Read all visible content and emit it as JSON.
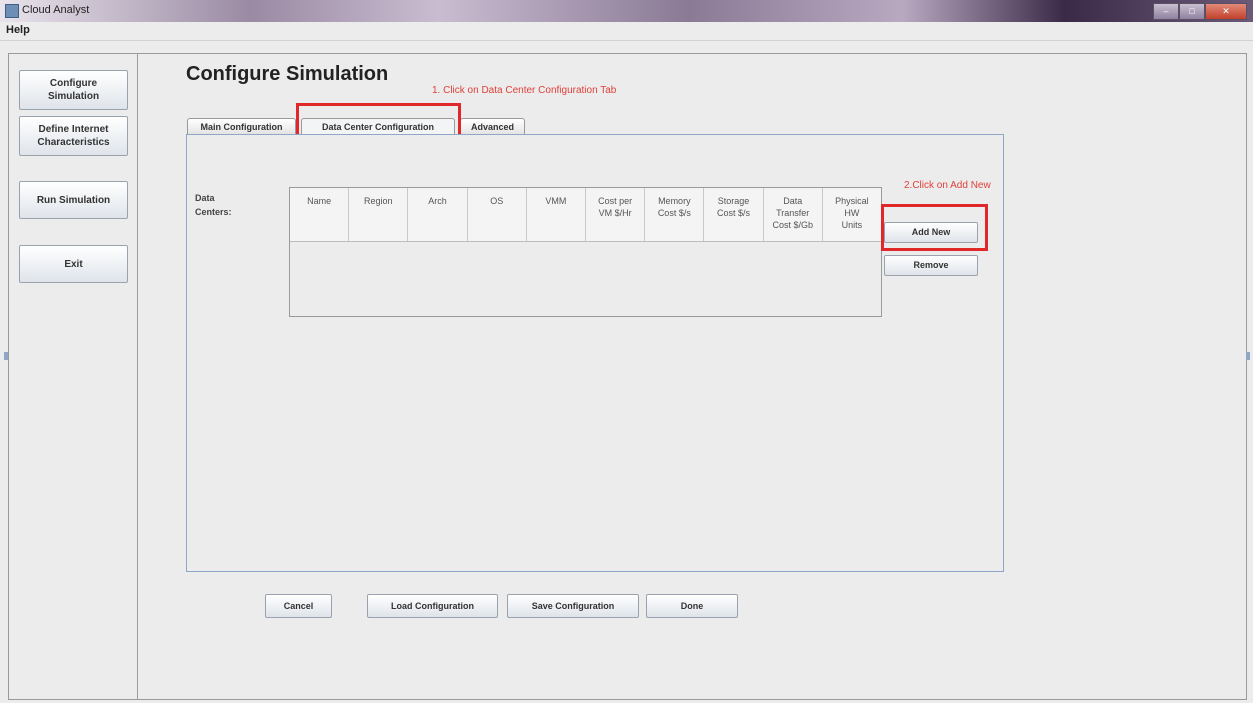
{
  "window": {
    "title": "Cloud Analyst"
  },
  "menu": {
    "items": [
      "Help"
    ]
  },
  "sidebar": {
    "items": [
      {
        "label": "Configure\nSimulation"
      },
      {
        "label": "Define Internet\nCharacteristics"
      },
      {
        "label": "Run Simulation"
      },
      {
        "label": "Exit"
      }
    ]
  },
  "main": {
    "title": "Configure Simulation",
    "tabs": [
      {
        "label": "Main Configuration"
      },
      {
        "label": "Data Center Configuration"
      },
      {
        "label": "Advanced"
      }
    ],
    "data_centers_label": "Data\nCenters:",
    "table": {
      "columns": [
        "Name",
        "Region",
        "Arch",
        "OS",
        "VMM",
        "Cost per\nVM $/Hr",
        "Memory\nCost $/s",
        "Storage\nCost $/s",
        "Data\nTransfer\nCost $/Gb",
        "Physical\nHW\nUnits"
      ],
      "rows": []
    },
    "add_new_label": "Add New",
    "remove_label": "Remove"
  },
  "footer": {
    "cancel_label": "Cancel",
    "load_label": "Load Configuration",
    "save_label": "Save Configuration",
    "done_label": "Done"
  },
  "annotations": {
    "step1": "1. Click on Data Center Configuration Tab",
    "step2": "2.Click on Add New"
  },
  "colors": {
    "annotation": "#e0403a",
    "highlight_box": "#e0282a"
  }
}
